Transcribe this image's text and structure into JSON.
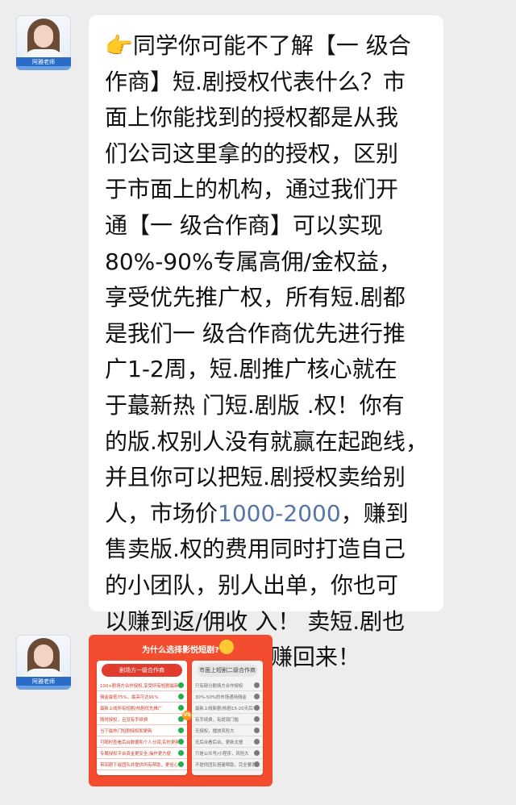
{
  "sender": {
    "avatar_name": "阿雅老师",
    "avatar_subtitle": "影悦短剧",
    "avatar_icon": "teacher-avatar"
  },
  "message": {
    "emoji": "👉",
    "body_before_price": "同学你可能不了解【一 级合\n作商】短.剧授权代表什么？市\n面上你能找到的授权都是从我\n们公司这里拿的的授权，区别\n于市面上的机构，通过我们开\n通【一 级合作商】可以实现\n80%-90%专属高佣/金权益，\n享受优先推广权，所有短.剧都\n是我们一 级合作商优先进行推\n广1-2周，短.剧推广核心就在\n于蕞新热 门短.剧版 .权！你有\n的版.权别人没有就赢在起跑线，\n并且你可以把短.剧授权卖给别\n人，市场价",
    "price": "1000-2000",
    "body_after_price": "，赚到\n售卖版.权的费用同时打造自己\n的小团队，别人出单，你也可\n以赚到返/佣收 入！ 卖短.剧也\n能把这些版.权钱赚回来！"
  },
  "image_message": {
    "title": "为什么选择影悦短剧?",
    "left_head": "剧场方一级合作商",
    "right_head": "市面上短剧二级合作商",
    "vs_label": "VS",
    "left_items": [
      "100+剧场方合作授权,享受所有短剧最新资源",
      "佣金最低75%，最高可达91%",
      "最新上线所有短剧/热剧优先推广",
      "随时授权，且没有手续费",
      "当下最热门短剧授权和更新",
      "可随时查看后台数据和个人分润,实时更新",
      "专属授权平台资金更安全,操作更方便",
      "带回避下级团队并提供所有帮助，更省心"
    ],
    "right_items": [
      "只有部分剧场方合作授权",
      "30%-50%的市场通用佣金",
      "最新上线新剧/热剧15-20天后才可推广",
      "有手续费，有提现门槛",
      "无授权，播放风险大",
      "无后台看后台，更新太慢",
      "只是公众号/小程序，风险大",
      "不提供团队搭建帮助，完全要靠自己做"
    ],
    "brand_color": "#f34c2e"
  }
}
